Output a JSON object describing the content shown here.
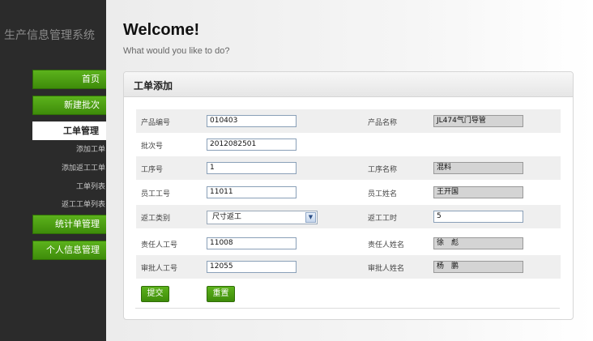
{
  "sidebar": {
    "brand": "生产信息管理系统",
    "nav": {
      "home": "首页",
      "new_batch": "新建批次",
      "work_order_mgmt": "工单管理",
      "stats_mgmt": "统计单管理",
      "personal_mgmt": "个人信息管理"
    },
    "subnav": {
      "add_work_order": "添加工单",
      "add_rework_order": "添加返工工单",
      "work_order_list": "工单列表",
      "rework_order_list": "返工工单列表"
    }
  },
  "header": {
    "title": "Welcome!",
    "subtitle": "What would you like to do?"
  },
  "panel": {
    "title": "工单添加"
  },
  "form": {
    "product_code": {
      "label": "产品编号",
      "value": "010403"
    },
    "product_name": {
      "label": "产品名称",
      "value": "JL474气门导管"
    },
    "batch_no": {
      "label": "批次号",
      "value": "2012082501"
    },
    "process_no": {
      "label": "工序号",
      "value": "1"
    },
    "process_name": {
      "label": "工序名称",
      "value": "混料"
    },
    "employee_no": {
      "label": "员工工号",
      "value": "11011"
    },
    "employee_name": {
      "label": "员工姓名",
      "value": "王开国"
    },
    "rework_type": {
      "label": "返工类别",
      "value": "尺寸返工"
    },
    "rework_hours": {
      "label": "返工工时",
      "value": "5"
    },
    "responsible_no": {
      "label": "责任人工号",
      "value": "11008"
    },
    "responsible_name": {
      "label": "责任人姓名",
      "value": "徐　彪"
    },
    "approver_no": {
      "label": "审批人工号",
      "value": "12055"
    },
    "approver_name": {
      "label": "审批人姓名",
      "value": "杨　鹏"
    }
  },
  "actions": {
    "submit": "提交",
    "reset": "重置"
  }
}
